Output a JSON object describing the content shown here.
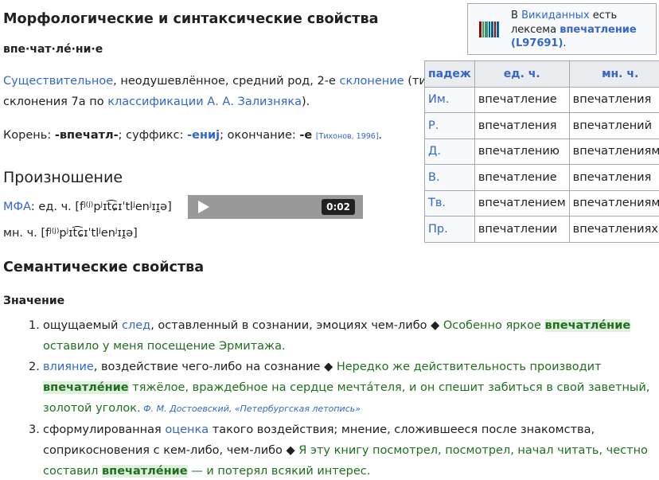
{
  "sections": {
    "morph_title": "Морфологические и синтаксические свойства",
    "pron_title": "Произношение",
    "sem_title": "Семантические свойства",
    "meaning_title": "Значение"
  },
  "morph": {
    "syllables": "впе·чат·ле́·ни·е",
    "pos_link": "Существительное",
    "pos_text": ", неодушевлённое, средний род, 2-е ",
    "decl_link": "склонение",
    "pos_tail": " (тип",
    "line2_pre": "склонения 7a по ",
    "classif_link": "классификации А. А. Зализняка",
    "line2_post": ").",
    "root_pre": "Корень: ",
    "root": "-впечатл-",
    "suffix_pre": "; суффикс: ",
    "suffix": "-ениj",
    "ending_pre": "; окончание: ",
    "ending": "-е",
    "ref": "[Тихонов, 1996]",
    "ref_post": "."
  },
  "pron": {
    "ipa_link": "МФА",
    "sg_label": ": ед. ч. [",
    "sg_ipa": "fʲ⁽ʲ⁾pʲɪt͡ɕɪˈtlʲenʲɪɪ̯ə",
    "sg_close": "]",
    "pl_label": "мн. ч. [",
    "pl_ipa": "fʲ⁽ʲ⁾pʲɪt͡ɕɪˈtlʲenʲɪɪ̯ə",
    "pl_close": "]",
    "player_time": "0:02"
  },
  "wikidata": {
    "t1": "В ",
    "link1": "Викиданных",
    "t2": " есть лексема ",
    "lexeme": "впечатление",
    "id": "(L97691)",
    "t3": "."
  },
  "declension": {
    "headers": [
      "падеж",
      "ед. ч.",
      "мн. ч."
    ],
    "rows": [
      [
        "Им.",
        "впечатление",
        "впечатления"
      ],
      [
        "Р.",
        "впечатления",
        "впечатлений"
      ],
      [
        "Д.",
        "впечатлению",
        "впечатлениям"
      ],
      [
        "В.",
        "впечатление",
        "впечатления"
      ],
      [
        "Тв.",
        "впечатлением",
        "впечатлениями"
      ],
      [
        "Пр.",
        "впечатлении",
        "впечатлениях"
      ]
    ]
  },
  "definitions": [
    {
      "num": "1.",
      "text_pre": "ощущаемый ",
      "link": "след",
      "text_post": ", оставленный в сознании, эмоциях чем-либо ◆ ",
      "ex_pre": "Особенно яркое ",
      "ex_word": "впечатле́ние",
      "ex_post": " оставило у меня посещение Эрмитажа.",
      "attr": ""
    },
    {
      "num": "2.",
      "text_pre": "",
      "link": "влияние",
      "text_post": ", воздействие чего-либо на сознание ◆ ",
      "ex_pre": "Нередко же действительность производит ",
      "ex_word": "впечатле́ние",
      "ex_post": " тяжёлое, враждебное на сердце мечта́теля, и он спешит забиться в свой заветный, золотой уголок.",
      "attr": " Ф. М. Достоевский, «Петербургская летопись»"
    },
    {
      "num": "3.",
      "text_pre": "сформулированная ",
      "link": "оценка",
      "text_post": " такого воздействия; мнение, сложившееся после знакомства, соприкосновения с кем-либо, чем-либо ◆ ",
      "ex_pre": "Я эту книгу посмотрел, посмотрел, начал читать, честно составил ",
      "ex_word": "впечатле́ние",
      "ex_post": " — и потерял всякий интерес.",
      "attr": ""
    }
  ],
  "colors": {
    "link": "#3366cc",
    "example": "#1f6f1f",
    "player_bg": "#999999"
  }
}
